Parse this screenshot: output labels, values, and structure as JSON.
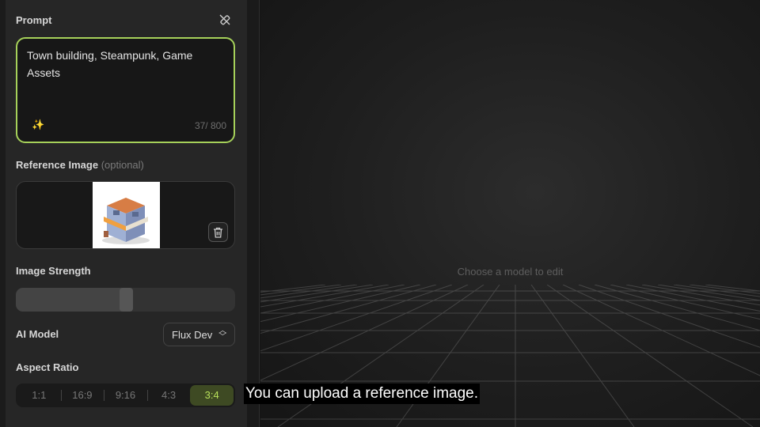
{
  "prompt": {
    "label": "Prompt",
    "text": "Town building, Steampunk, Game Assets",
    "count": "37/ 800",
    "clear_icon": "eraser-icon",
    "enhance_icon": "magic-wand-icon",
    "accent": "#a6d15a"
  },
  "reference": {
    "label": "Reference Image",
    "optional": "(optional)",
    "delete_icon": "trash-icon"
  },
  "strength": {
    "label": "Image Strength",
    "value": 0.5
  },
  "model": {
    "label": "AI Model",
    "value": "Flux Dev"
  },
  "aspect": {
    "label": "Aspect Ratio",
    "options": [
      "1:1",
      "16:9",
      "9:16",
      "4:3",
      "3:4"
    ],
    "selected": "3:4"
  },
  "main": {
    "hint": "Choose a model to edit"
  },
  "caption": "You can upload a reference image."
}
